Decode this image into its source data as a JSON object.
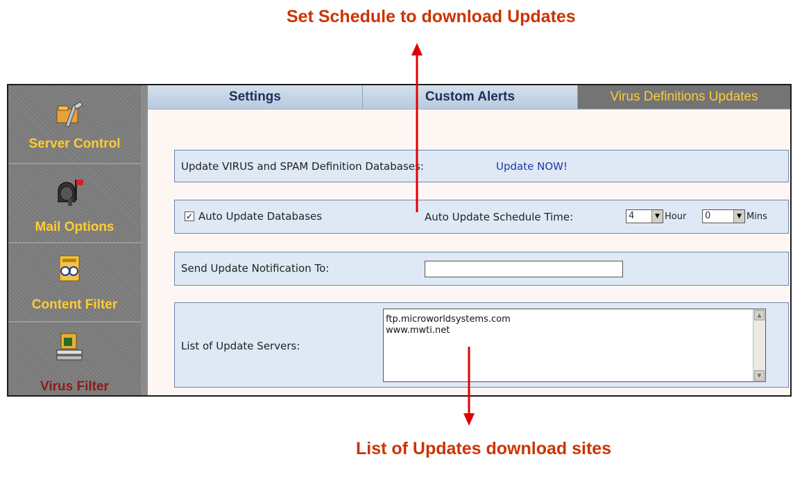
{
  "callouts": {
    "top": "Set Schedule to download Updates",
    "bottom": "List of Updates download sites"
  },
  "sidebar": {
    "items": [
      {
        "label": "Server Control",
        "icon": "server-control-icon"
      },
      {
        "label": "Mail Options",
        "icon": "mailbox-icon"
      },
      {
        "label": "Content Filter",
        "icon": "content-filter-icon"
      },
      {
        "label": "Virus Filter",
        "icon": "virus-filter-icon",
        "active": true
      }
    ]
  },
  "tabs": [
    {
      "label": "Settings"
    },
    {
      "label": "Custom Alerts"
    },
    {
      "label": "Virus Definitions Updates",
      "active": true
    }
  ],
  "update_panel": {
    "label": "Update VIRUS and SPAM Definition Databases:",
    "link": "Update NOW!"
  },
  "auto_panel": {
    "checkbox_label": "Auto Update Databases",
    "checked": true,
    "checkbox_mark": "✓",
    "schedule_label": "Auto Update Schedule Time:",
    "hour_value": "4",
    "hour_label": "Hour",
    "mins_value": "0",
    "mins_label": "Mins"
  },
  "notify_panel": {
    "label": "Send Update Notification To:",
    "value": ""
  },
  "servers_panel": {
    "label": "List of Update Servers:",
    "servers": [
      "ftp.microworldsystems.com",
      "www.mwti.net"
    ]
  },
  "colors": {
    "callout": "#cc3300",
    "sidebar_label": "#ffcc33",
    "active_tab_bg": "#747474",
    "panel_bg": "#dfe9f6"
  }
}
